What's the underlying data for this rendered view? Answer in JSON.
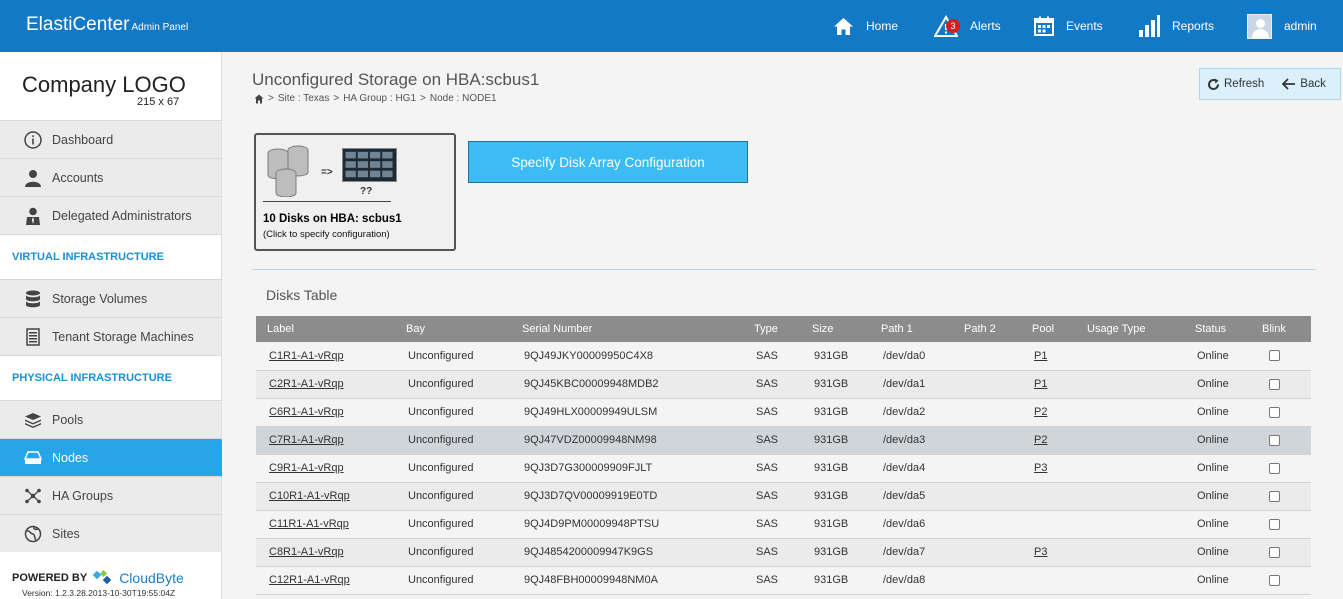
{
  "header": {
    "brand": "ElastiCenter",
    "brand_sub": "Admin Panel",
    "nav": {
      "home": "Home",
      "alerts": "Alerts",
      "alerts_count": "3",
      "events": "Events",
      "reports": "Reports",
      "user": "admin"
    }
  },
  "sidebar": {
    "logo_title": "Company LOGO",
    "logo_dims": "215 x 67",
    "items_top": [
      "Dashboard",
      "Accounts",
      "Delegated Administrators"
    ],
    "section_virtual": "VIRTUAL INFRASTRUCTURE",
    "items_virtual": [
      "Storage Volumes",
      "Tenant Storage Machines"
    ],
    "section_physical": "PHYSICAL INFRASTRUCTURE",
    "items_physical": [
      "Pools",
      "Nodes",
      "HA Groups",
      "Sites"
    ],
    "active_item": "Nodes",
    "powered_by": "POWERED BY",
    "powered_brand": "CloudByte",
    "version": "Version: 1.2.3.28.2013-10-30T19:55:04Z"
  },
  "main": {
    "title": "Unconfigured Storage on HBA:scbus1",
    "breadcrumb": [
      "Site : Texas",
      "HA Group : HG1",
      "Node : NODE1"
    ],
    "breadcrumb_sep": ">",
    "toolbar": {
      "refresh": "Refresh",
      "back": "Back"
    },
    "card": {
      "arrow": "=>",
      "unknown": "??",
      "line1": "10 Disks on HBA: scbus1",
      "line2": "(Click to specify configuration)"
    },
    "specify_button": "Specify Disk Array Configuration",
    "table_title": "Disks Table",
    "columns": [
      "Label",
      "Bay",
      "Serial Number",
      "Type",
      "Size",
      "Path 1",
      "Path 2",
      "Pool",
      "Usage Type",
      "Status",
      "Blink"
    ],
    "rows": [
      {
        "label": "C1R1-A1-vRqp",
        "bay": "Unconfigured",
        "serial": "9QJ49JKY00009950C4X8",
        "type": "SAS",
        "size": "931GB",
        "path1": "/dev/da0",
        "path2": "",
        "pool": "P1",
        "usage": "",
        "status": "Online"
      },
      {
        "label": "C2R1-A1-vRqp",
        "bay": "Unconfigured",
        "serial": "9QJ45KBC00009948MDB2",
        "type": "SAS",
        "size": "931GB",
        "path1": "/dev/da1",
        "path2": "",
        "pool": "P1",
        "usage": "",
        "status": "Online"
      },
      {
        "label": "C6R1-A1-vRqp",
        "bay": "Unconfigured",
        "serial": "9QJ49HLX00009949ULSM",
        "type": "SAS",
        "size": "931GB",
        "path1": "/dev/da2",
        "path2": "",
        "pool": "P2",
        "usage": "",
        "status": "Online"
      },
      {
        "label": "C7R1-A1-vRqp",
        "bay": "Unconfigured",
        "serial": "9QJ47VDZ00009948NM98",
        "type": "SAS",
        "size": "931GB",
        "path1": "/dev/da3",
        "path2": "",
        "pool": "P2",
        "usage": "",
        "status": "Online"
      },
      {
        "label": "C9R1-A1-vRqp",
        "bay": "Unconfigured",
        "serial": "9QJ3D7G300009909FJLT",
        "type": "SAS",
        "size": "931GB",
        "path1": "/dev/da4",
        "path2": "",
        "pool": "P3",
        "usage": "",
        "status": "Online"
      },
      {
        "label": "C10R1-A1-vRqp",
        "bay": "Unconfigured",
        "serial": "9QJ3D7QV00009919E0TD",
        "type": "SAS",
        "size": "931GB",
        "path1": "/dev/da5",
        "path2": "",
        "pool": "",
        "usage": "",
        "status": "Online"
      },
      {
        "label": "C11R1-A1-vRqp",
        "bay": "Unconfigured",
        "serial": "9QJ4D9PM00009948PTSU",
        "type": "SAS",
        "size": "931GB",
        "path1": "/dev/da6",
        "path2": "",
        "pool": "",
        "usage": "",
        "status": "Online"
      },
      {
        "label": "C8R1-A1-vRqp",
        "bay": "Unconfigured",
        "serial": "9QJ4854200009947K9GS",
        "type": "SAS",
        "size": "931GB",
        "path1": "/dev/da7",
        "path2": "",
        "pool": "P3",
        "usage": "",
        "status": "Online"
      },
      {
        "label": "C12R1-A1-vRqp",
        "bay": "Unconfigured",
        "serial": "9QJ48FBH00009948NM0A",
        "type": "SAS",
        "size": "931GB",
        "path1": "/dev/da8",
        "path2": "",
        "pool": "",
        "usage": "",
        "status": "Online"
      }
    ],
    "highlight_row": 3
  },
  "colors": {
    "header_bg": "#1279c6",
    "accent": "#26a6e8",
    "section_text": "#1b8fd0",
    "button_bg": "#3cbcf5",
    "alert_badge": "#d21f1f",
    "table_header": "#8c8c8c"
  },
  "icons": {
    "home": "home-icon",
    "alerts": "warning-icon",
    "events": "calendar-icon",
    "reports": "bar-chart-icon",
    "refresh": "refresh-icon",
    "back": "back-arrow-icon"
  }
}
